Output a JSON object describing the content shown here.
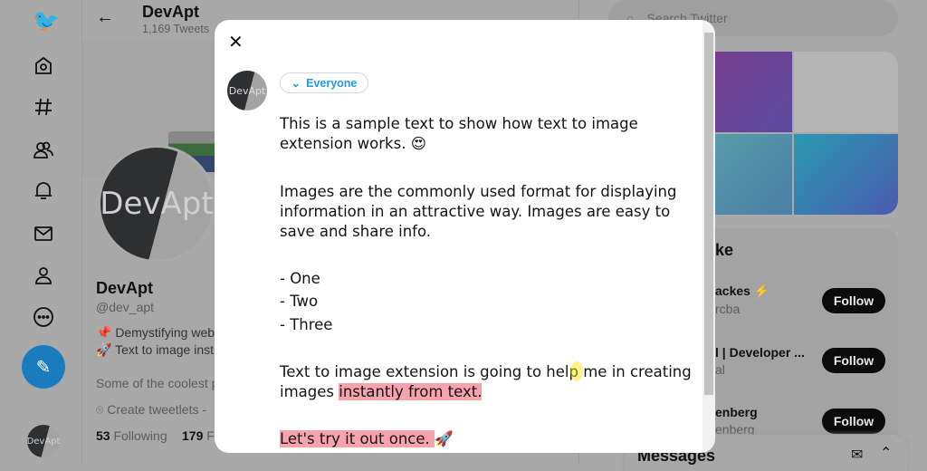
{
  "sidebar": {
    "items": [
      "twitter-logo",
      "home",
      "explore",
      "communities",
      "notifications",
      "messages",
      "profile",
      "more"
    ],
    "compose": "compose-tweet",
    "account_avatar": "DevApt"
  },
  "profile": {
    "header_name": "DevApt",
    "tweet_count": "1,169 Tweets",
    "avatar_text": "DevApt",
    "name": "DevApt",
    "handle": "@dev_apt",
    "bio_line1": "📌 Demystifying web",
    "bio_line2": "🚀 Text to image inst",
    "bio_line3": "Some of the coolest p",
    "location": "Create tweetlets -",
    "following_count": "53",
    "following_label": "Following",
    "followers_count": "179",
    "followers_label": "F"
  },
  "right": {
    "search_placeholder": "Search Twitter",
    "who_to_follow_title": "ke",
    "suggestions": [
      {
        "name": "ackes ⚡",
        "handle": "rcba",
        "button": "Follow"
      },
      {
        "name": "l | Developer ...",
        "handle": "al",
        "button": "Follow"
      },
      {
        "name": "enberg",
        "handle": "enberg",
        "button": "Follow"
      }
    ],
    "messages_title": "Messages"
  },
  "modal": {
    "audience": "Everyone",
    "avatar_text": "DevApt",
    "lines": [
      "This is a sample text to show how text to image",
      "extension works.  😍",
      "Images are the commonly used format for displaying",
      "information in an attractive way. Images are easy to",
      "save and share info.",
      "- One",
      "- Two",
      "- Three",
      "Text to image extension is going to help me in creating",
      "images "
    ],
    "highlight1": "instantly from text.",
    "highlight2": "Let's try it out once. ",
    "rocket": "🚀"
  },
  "colors": {
    "accent": "#1d9bf0",
    "highlight": "#f7a3ae"
  }
}
